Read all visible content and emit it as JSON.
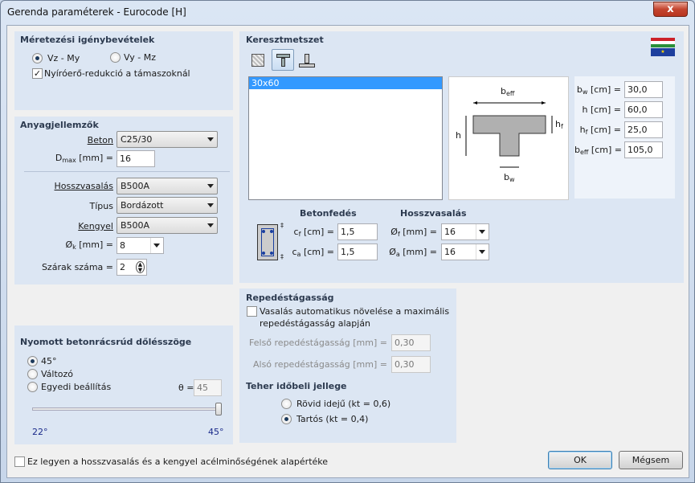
{
  "window": {
    "title": "Gerenda paraméterek - Eurocode [H]",
    "close": "x"
  },
  "design": {
    "title": "Méretezési igénybevételek",
    "radio1": "Vz - My",
    "radio2": "Vy - Mz",
    "check": "Nyíróerő-redukció a támaszoknál"
  },
  "material": {
    "title": "Anyagjellemzők",
    "beton_label": "Beton",
    "beton_value": "C25/30",
    "dmax_label": "D",
    "dmax_sub": "max",
    "dmax_unit": "[mm] =",
    "dmax_value": "16",
    "long_label": "Hosszvasalás",
    "long_value": "B500A",
    "type_label": "Típus",
    "type_value": "Bordázott",
    "stirrup_label": "Kengyel",
    "stirrup_value": "B500A",
    "phik_label": "Ø",
    "phik_sub": "k",
    "phik_unit": "[mm] =",
    "phik_value": "8",
    "legs_label": "Szárak száma =",
    "legs_value": "2"
  },
  "strut": {
    "title": "Nyomott betonrácsrúd dőlésszöge",
    "opt1": "45°",
    "opt2": "Változó",
    "opt3": "Egyedi beállítás",
    "theta_label": "θ =",
    "theta_value": "45",
    "slider_min": "22°",
    "slider_max": "45°",
    "slider_level": 1.0
  },
  "section": {
    "title": "Keresztmetszet",
    "list": [
      "30x60"
    ],
    "diagram": {
      "beff": "b",
      "beff_sub": "eff",
      "h": "h",
      "hf": "h",
      "hf_sub": "f",
      "bw": "b",
      "bw_sub": "w"
    },
    "params": [
      {
        "label": "b",
        "sub": "w",
        "unit": "[cm] =",
        "value": "30,0"
      },
      {
        "label": "h",
        "sub": "",
        "unit": "[cm] =",
        "value": "60,0"
      },
      {
        "label": "h",
        "sub": "f",
        "unit": "[cm] =",
        "value": "25,0"
      },
      {
        "label": "b",
        "sub": "eff",
        "unit": "[cm] =",
        "value": "105,0"
      }
    ],
    "cover": {
      "title": "Betonfedés",
      "cf_label": "c",
      "cf_sub": "f",
      "cf_unit": "[cm] =",
      "cf_value": "1,5",
      "ca_label": "c",
      "ca_sub": "a",
      "ca_unit": "[cm] =",
      "ca_value": "1,5"
    },
    "rebar": {
      "title": "Hosszvasalás",
      "phif_label": "Ø",
      "phif_sub": "f",
      "phif_unit": "[mm] =",
      "phif_value": "16",
      "phia_label": "Ø",
      "phia_sub": "a",
      "phia_unit": "[mm] =",
      "phia_value": "16"
    }
  },
  "crack": {
    "title": "Repedéstágasság",
    "check": "Vasalás automatikus növelése a maximális",
    "check2": "repedéstágasság alapján",
    "upper_label": "Felső repedéstágasság [mm] =",
    "upper_value": "0,30",
    "lower_label": "Alsó repedéstágasság [mm] =",
    "lower_value": "0,30",
    "load_title": "Teher időbeli jellege",
    "short": "Rövid idejű (kt = 0,6)",
    "long": "Tartós (kt = 0,4)"
  },
  "footer": {
    "default_check": "Ez legyen a hosszvasalás és a kengyel acélminőségének alapértéke",
    "ok": "OK",
    "cancel": "Mégsem"
  }
}
